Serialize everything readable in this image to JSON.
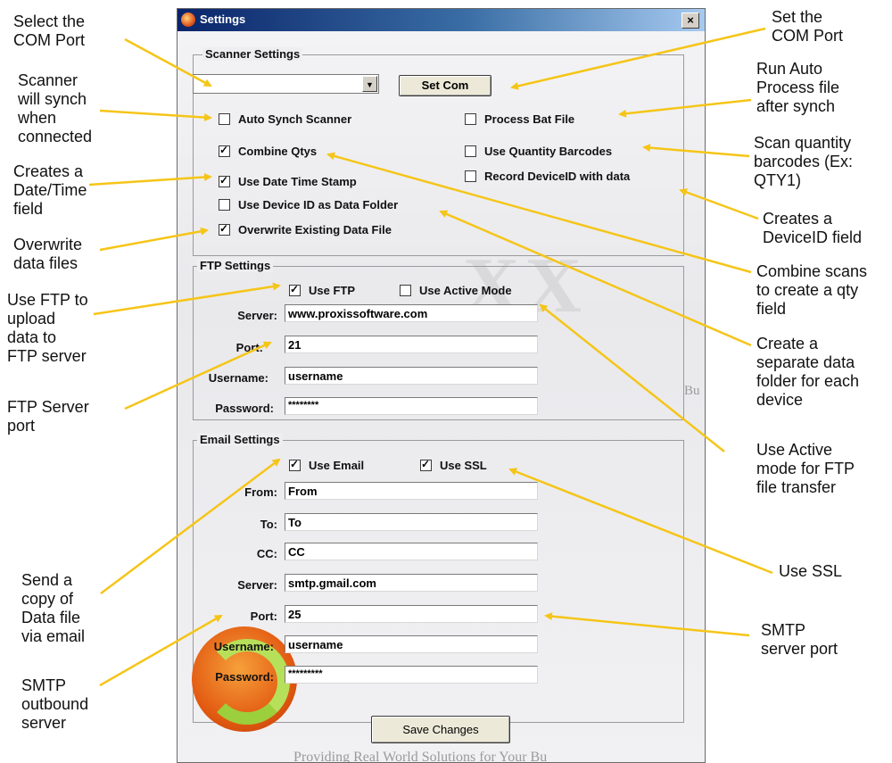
{
  "window": {
    "title": "Settings",
    "close_symbol": "×"
  },
  "annotations": {
    "select_com_port": "Select the\nCOM Port",
    "auto_synch": "Scanner\nwill synch\nwhen\nconnected",
    "date_time": "Creates a\nDate/Time\nfield",
    "overwrite": "Overwrite\ndata files",
    "use_ftp": "Use FTP to\nupload\ndata to\nFTP server",
    "ftp_port": "FTP Server\nport",
    "send_email": "Send a\ncopy of\nData file\nvia email",
    "smtp_server": "SMTP\noutbound\nserver",
    "set_com": "Set the\nCOM Port",
    "process_bat": "Run Auto\nProcess file\nafter synch",
    "qty_barcodes": "Scan quantity\nbarcodes (Ex:\nQTY1)",
    "device_id_field": "Creates a\nDeviceID field",
    "combine_scans": "Combine scans\nto create a qty\nfield",
    "separate_folder": "Create a\nseparate data\nfolder for each\ndevice",
    "active_mode": "Use Active\nmode for FTP\nfile transfer",
    "use_ssl": "Use SSL",
    "smtp_port": "SMTP\nserver port"
  },
  "scanner": {
    "label": "Scanner Settings",
    "com_value": "",
    "set_com_label": "Set Com",
    "checkboxes": [
      {
        "label": "Auto Synch Scanner",
        "checked": false
      },
      {
        "label": "Combine Qtys",
        "checked": true
      },
      {
        "label": "Use Date Time Stamp",
        "checked": true
      },
      {
        "label": "Use Device ID as Data Folder",
        "checked": false
      },
      {
        "label": "Overwrite Existing Data File",
        "checked": true
      },
      {
        "label": "Process Bat File",
        "checked": false
      },
      {
        "label": "Use Quantity Barcodes",
        "checked": false
      },
      {
        "label": "Record DeviceID with data",
        "checked": false
      }
    ]
  },
  "ftp": {
    "label": "FTP Settings",
    "use_ftp": {
      "label": "Use FTP",
      "checked": true
    },
    "use_active": {
      "label": "Use Active Mode",
      "checked": false
    },
    "server_label": "Server:",
    "server": "www.proxissoftware.com",
    "port_label": "Port:",
    "port": "21",
    "username_label": "Username:",
    "username": "username",
    "password_label": "Password:",
    "password": "********"
  },
  "email": {
    "label": "Email Settings",
    "use_email": {
      "label": "Use Email",
      "checked": true
    },
    "use_ssl": {
      "label": "Use SSL",
      "checked": true
    },
    "from_label": "From:",
    "from": "From",
    "to_label": "To:",
    "to": "To",
    "cc_label": "CC:",
    "cc": "CC",
    "server_label": "Server:",
    "server": "smtp.gmail.com",
    "port_label": "Port:",
    "port": "25",
    "username_label": "Username:",
    "username": "username",
    "password_label": "Password:",
    "password": "*********"
  },
  "save_label": "Save Changes",
  "background_text": {
    "bu": "Bu",
    "footer": "Providing Real World Solutions for Your Bu"
  },
  "colors": {
    "arrow": "#f5c518",
    "title_start": "#0a246a",
    "title_end": "#a6caf0"
  }
}
